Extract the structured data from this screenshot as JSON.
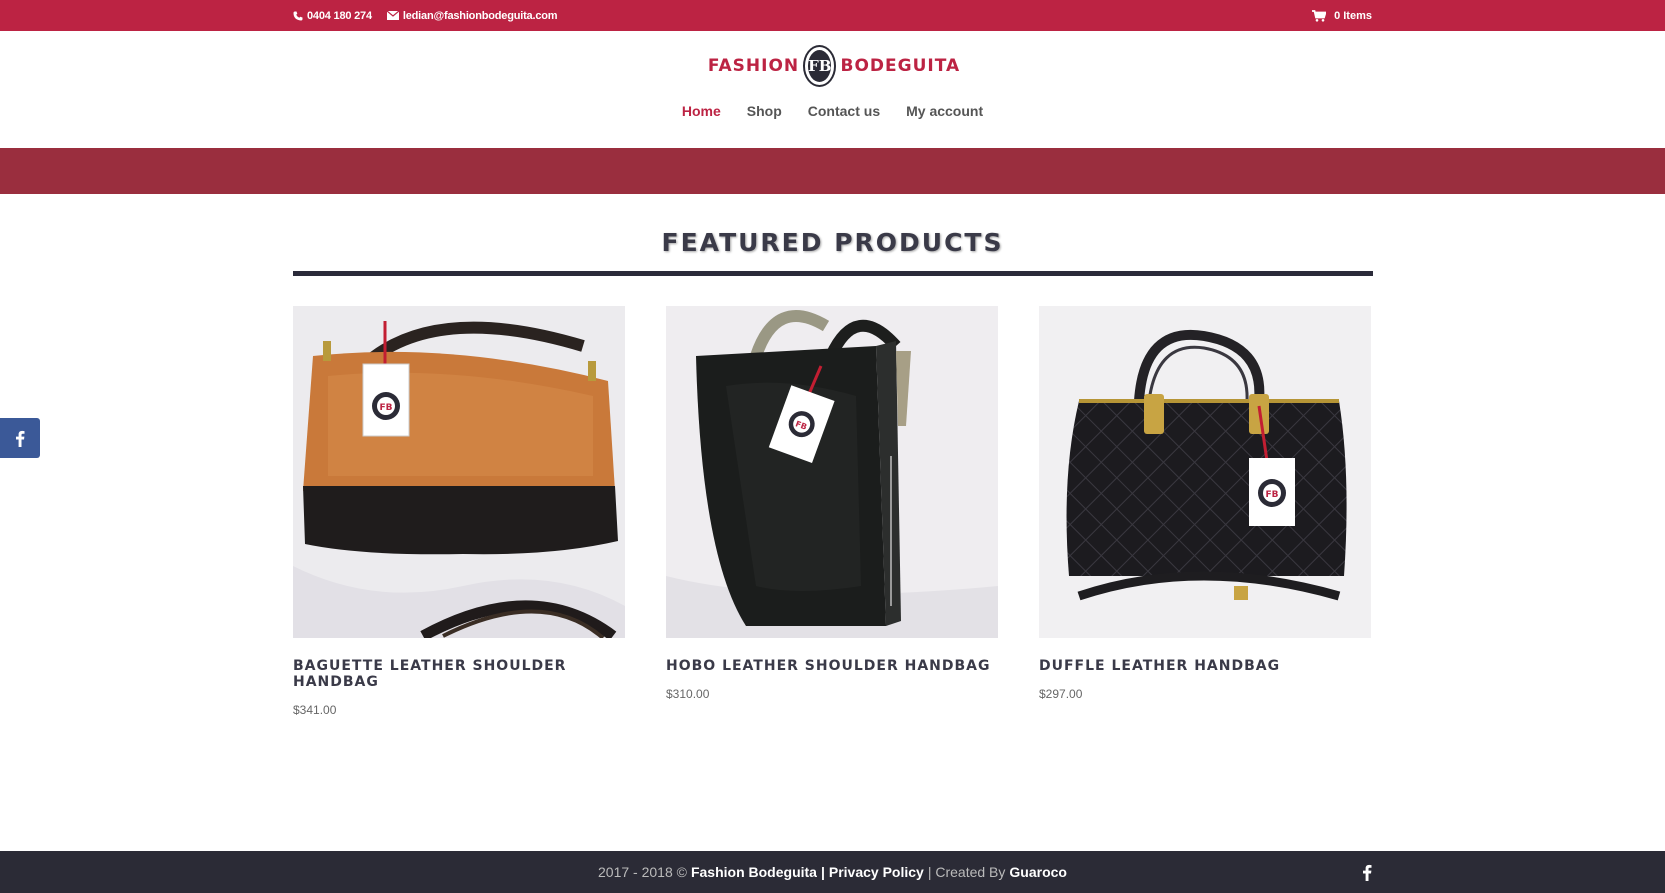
{
  "topbar": {
    "phone": "0404 180 274",
    "email": "ledian@fashionbodeguita.com",
    "cart": "0 Items",
    "bg_color": "#bc2343"
  },
  "logo": {
    "left_text": "FASHION",
    "badge": "FB",
    "right_text": "BODEGUITA"
  },
  "nav": {
    "items": [
      {
        "label": "Home",
        "active": true
      },
      {
        "label": "Shop",
        "active": false
      },
      {
        "label": "Contact us",
        "active": false
      },
      {
        "label": "My account",
        "active": false
      }
    ]
  },
  "band_color": "#9a2e3e",
  "featured": {
    "title": "Featured Products",
    "products": [
      {
        "name": "Baguette Leather Shoulder Handbag",
        "price": "$341.00",
        "image_icon": "tan-black-handbag-image"
      },
      {
        "name": "Hobo Leather Shoulder Handbag",
        "price": "$310.00",
        "image_icon": "black-hobo-handbag-image"
      },
      {
        "name": "Duffle Leather Handbag",
        "price": "$297.00",
        "image_icon": "quilted-black-handbag-image"
      }
    ]
  },
  "footer": {
    "years": "2017 - 2018 ©",
    "brand": "Fashion Bodeguita",
    "sep1": "|",
    "privacy": "Privacy Policy",
    "sep2": "| Created By",
    "creator": "Guaroco"
  }
}
